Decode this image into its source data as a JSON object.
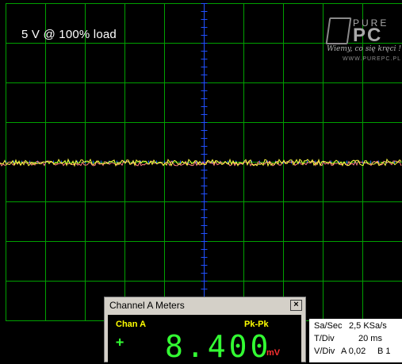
{
  "scope": {
    "title": "5 V @ 100% load",
    "colors": {
      "grid": "#00a000",
      "center": "#2050ff",
      "trace": "#ffff40",
      "trace2": "#ff8080"
    }
  },
  "logo": {
    "pure": "PURE",
    "pc": "PC",
    "tagline": "Wiemy, co się kręci !",
    "url": "WWW.PUREPC.PL"
  },
  "meter": {
    "title": "Channel A Meters",
    "close": "×",
    "channel": "Chan A",
    "mode": "Pk-Pk",
    "coupling": "+",
    "reading": "8.400",
    "unit": "mV"
  },
  "status": {
    "sa_label": "Sa/Sec",
    "sa_value": "2,5 KSa/s",
    "tdiv_label": "T/Div",
    "tdiv_value": "20 ms",
    "vdiv_label": "V/Div",
    "vdiv_a": "A 0,02",
    "vdiv_b": "B 1"
  }
}
